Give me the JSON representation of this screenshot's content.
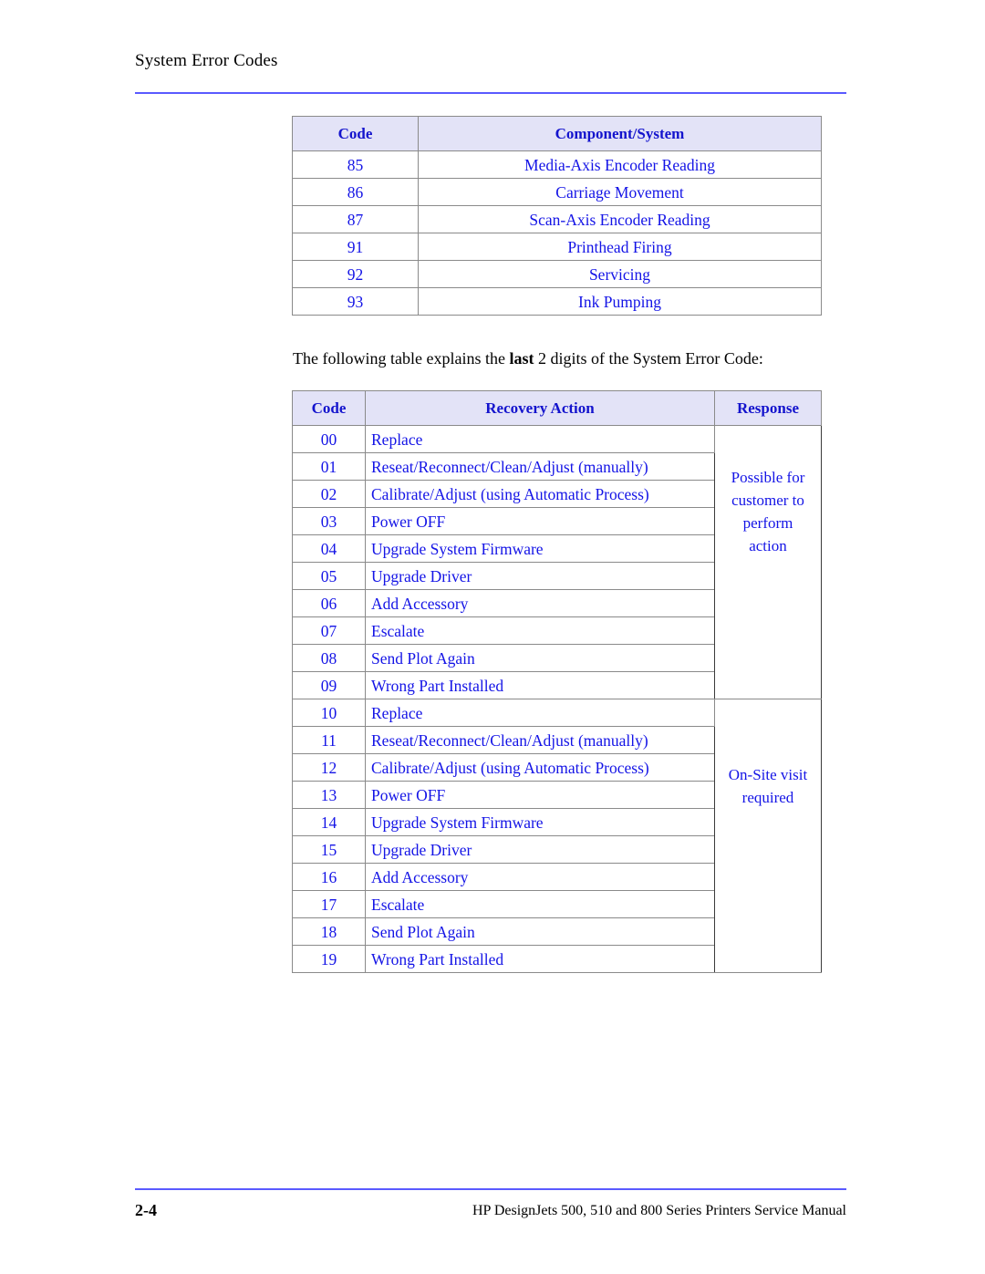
{
  "header": {
    "title": "System Error Codes"
  },
  "component_table": {
    "columns": [
      "Code",
      "Component/System"
    ],
    "rows": [
      {
        "code": "85",
        "component": "Media-Axis Encoder Reading"
      },
      {
        "code": "86",
        "component": "Carriage Movement"
      },
      {
        "code": "87",
        "component": "Scan-Axis Encoder Reading"
      },
      {
        "code": "91",
        "component": "Printhead Firing"
      },
      {
        "code": "92",
        "component": "Servicing"
      },
      {
        "code": "93",
        "component": "Ink Pumping"
      }
    ]
  },
  "intro": {
    "before": "The following table explains the ",
    "emphasis": "last",
    "after": " 2 digits of the System Error Code:"
  },
  "recovery_table": {
    "columns": [
      "Code",
      "Recovery Action",
      "Response"
    ],
    "response_groups": [
      "Possible for customer to perform action",
      "On-Site visit required"
    ],
    "rows": [
      {
        "code": "00",
        "action": "Replace"
      },
      {
        "code": "01",
        "action": "Reseat/Reconnect/Clean/Adjust (manually)"
      },
      {
        "code": "02",
        "action": "Calibrate/Adjust (using Automatic Process)"
      },
      {
        "code": "03",
        "action": "Power OFF"
      },
      {
        "code": "04",
        "action": "Upgrade System Firmware"
      },
      {
        "code": "05",
        "action": "Upgrade Driver"
      },
      {
        "code": "06",
        "action": "Add Accessory"
      },
      {
        "code": "07",
        "action": "Escalate"
      },
      {
        "code": "08",
        "action": "Send Plot Again"
      },
      {
        "code": "09",
        "action": "Wrong Part Installed"
      },
      {
        "code": "10",
        "action": "Replace"
      },
      {
        "code": "11",
        "action": "Reseat/Reconnect/Clean/Adjust (manually)"
      },
      {
        "code": "12",
        "action": "Calibrate/Adjust (using Automatic Process)"
      },
      {
        "code": "13",
        "action": "Power OFF"
      },
      {
        "code": "14",
        "action": "Upgrade System Firmware"
      },
      {
        "code": "15",
        "action": "Upgrade Driver"
      },
      {
        "code": "16",
        "action": "Add Accessory"
      },
      {
        "code": "17",
        "action": "Escalate"
      },
      {
        "code": "18",
        "action": "Send Plot Again"
      },
      {
        "code": "19",
        "action": "Wrong Part Installed"
      }
    ]
  },
  "footer": {
    "page_number": "2-4",
    "manual_title": "HP DesignJets 500, 510 and 800 Series Printers Service Manual"
  },
  "colors": {
    "table_text": "#1414e6",
    "header_text": "#1414cd",
    "header_background": "#e3e3f7",
    "rule": "#5a5aff",
    "border": "#8a8a8a",
    "body_text": "#000000"
  }
}
